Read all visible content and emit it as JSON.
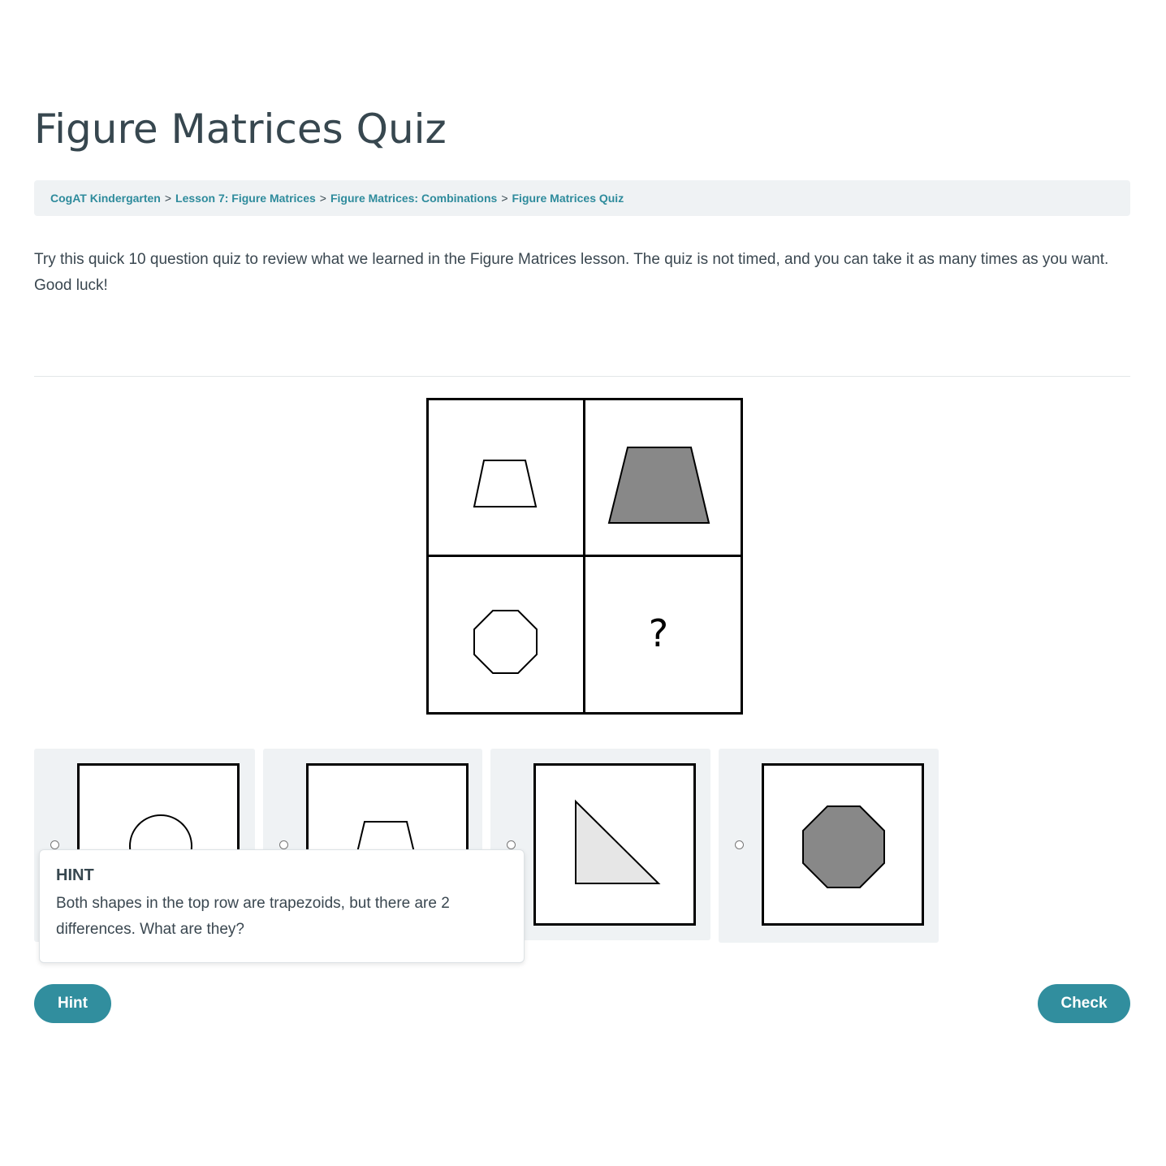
{
  "page": {
    "title": "Figure Matrices Quiz",
    "intro": "Try this quick 10 question quiz to review what we learned in the Figure Matrices lesson. The quiz is not timed, and you can take it as many times as you want. Good luck!"
  },
  "breadcrumb": {
    "items": [
      "CogAT Kindergarten",
      "Lesson 7: Figure Matrices",
      "Figure Matrices: Combinations",
      "Figure Matrices Quiz"
    ],
    "separator": ">"
  },
  "matrix": {
    "cells": [
      {
        "shape": "trapezoid",
        "size": "small",
        "fill": "white"
      },
      {
        "shape": "trapezoid",
        "size": "large",
        "fill": "gray"
      },
      {
        "shape": "octagon",
        "size": "small",
        "fill": "white"
      },
      {
        "shape": "unknown",
        "label": "?"
      }
    ]
  },
  "options": [
    {
      "shape": "circle",
      "fill": "white"
    },
    {
      "shape": "trapezoid",
      "fill": "white"
    },
    {
      "shape": "right-triangle",
      "fill": "light-gray"
    },
    {
      "shape": "octagon",
      "fill": "gray"
    }
  ],
  "hint": {
    "title": "HINT",
    "text": "Both shapes in the top row are trapezoids, but there are 2 differences. What are they?"
  },
  "buttons": {
    "hint_label": "Hint",
    "check_label": "Check"
  },
  "colors": {
    "accent": "#318e9e",
    "link": "#2e8b9c",
    "panel": "#eff2f4",
    "shape_gray": "#888888",
    "shape_light": "#e6e6e6"
  }
}
